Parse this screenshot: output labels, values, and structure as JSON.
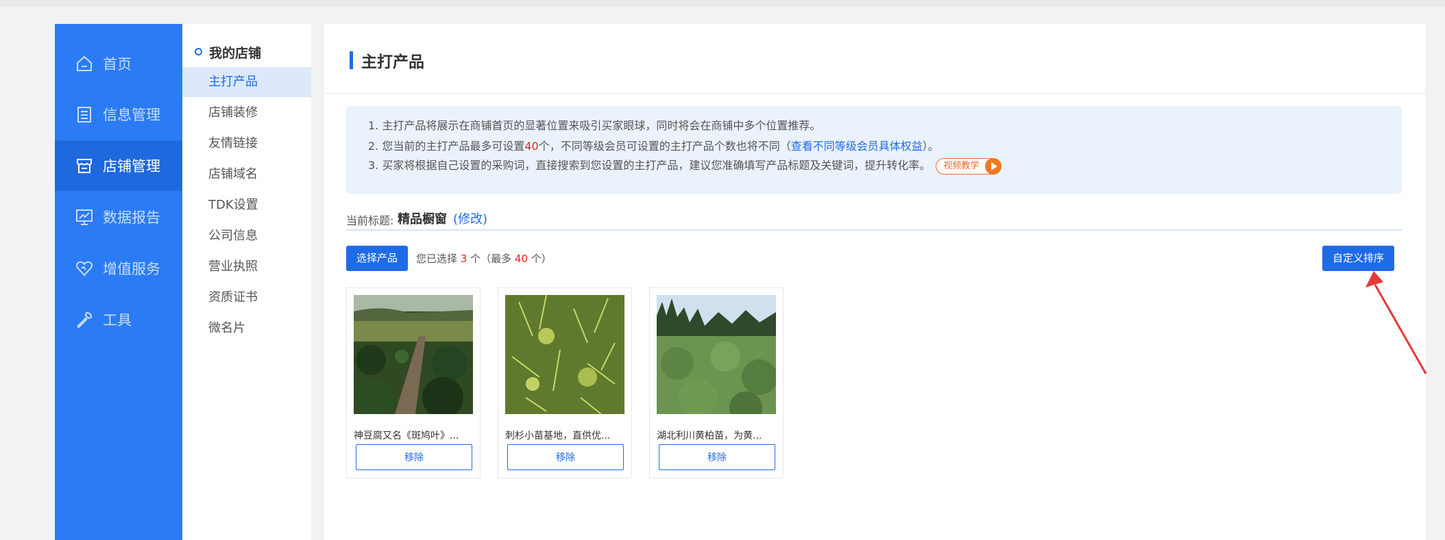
{
  "nav": {
    "items": [
      {
        "label": "首页",
        "icon": "home-icon"
      },
      {
        "label": "信息管理",
        "icon": "document-icon"
      },
      {
        "label": "店铺管理",
        "icon": "store-icon"
      },
      {
        "label": "数据报告",
        "icon": "chart-monitor-icon"
      },
      {
        "label": "增值服务",
        "icon": "heart-icon"
      },
      {
        "label": "工具",
        "icon": "wrench-icon"
      }
    ],
    "active": "店铺管理"
  },
  "submenu": {
    "heading": "我的店铺",
    "items": [
      "主打产品",
      "店铺装修",
      "友情链接",
      "店铺域名",
      "TDK设置",
      "公司信息",
      "营业执照",
      "资质证书",
      "微名片"
    ],
    "active": "主打产品"
  },
  "main": {
    "title": "主打产品",
    "notice": {
      "line1": "1. 主打产品将展示在商铺首页的显著位置来吸引买家眼球，同时将会在商铺中多个位置推荐。",
      "line2_pre": "2. 您当前的主打产品最多可设置",
      "line2_num": "40",
      "line2_mid": "个，不同等级会员可设置的主打产品个数也将不同（",
      "line2_link": "查看不同等级会员具体权益",
      "line2_post": "）。",
      "line3": "3. 买家将根据自己设置的采购词，直接搜索到您设置的主打产品，建议您准确填写产品标题及关键词，提升转化率。",
      "video_label": "视频教学"
    },
    "current_title_label": "当前标题:",
    "current_title_value": "精品橱窗",
    "current_title_edit": "(修改)",
    "select_button": "选择产品",
    "selected_pre": "您已选择",
    "selected_count": "3",
    "selected_mid": "个（最多",
    "selected_max": "40",
    "selected_post": "个）",
    "custom_sort_button": "自定义排序"
  },
  "products": [
    {
      "title": "神豆腐又名《斑鸠叶》...",
      "remove_label": "移除"
    },
    {
      "title": "刺杉小苗基地，直供优...",
      "remove_label": "移除"
    },
    {
      "title": "湖北利川黄柏苗，为黄...",
      "remove_label": "移除"
    }
  ],
  "colors": {
    "nav_bg": "#2b7cf4",
    "nav_active": "#1f69de",
    "primary": "#1e6be8",
    "notice_bg": "#eaf2fd",
    "red": "#e02424",
    "arrow": "#e53935"
  }
}
